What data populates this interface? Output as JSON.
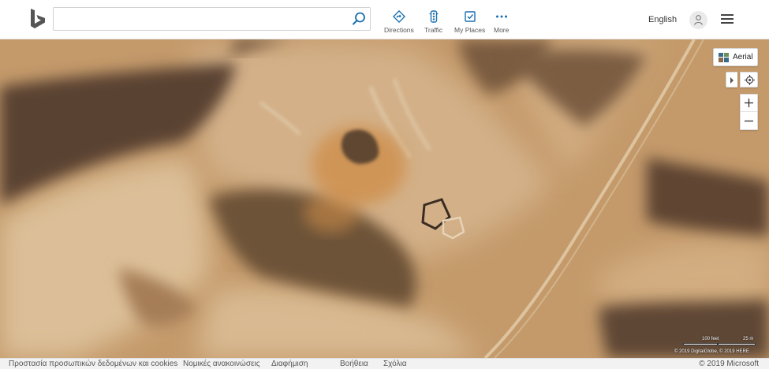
{
  "header": {
    "brand": "Bing",
    "search": {
      "value": "",
      "placeholder": ""
    },
    "nav": [
      {
        "label": "Directions",
        "icon": "directions-icon"
      },
      {
        "label": "Traffic",
        "icon": "traffic-icon"
      },
      {
        "label": "My Places",
        "icon": "my-places-icon"
      },
      {
        "label": "More",
        "icon": "more-icon"
      }
    ],
    "language": "English"
  },
  "map": {
    "style_label": "Aerial",
    "scale": {
      "imperial": "100 feet",
      "metric": "25 m"
    },
    "attribution": "© 2019 DigitalGlobe, © 2019 HERE"
  },
  "footer": {
    "links": [
      "Προστασία προσωπικών δεδομένων και cookies",
      "Νομικές ανακοινώσεις",
      "Διαφήμιση",
      "Βοήθεια",
      "Σχόλια"
    ],
    "copyright": "© 2019 Microsoft"
  },
  "colors": {
    "accent": "#0078d4",
    "sand": "#c99f6f",
    "shadow": "#5a4331"
  }
}
